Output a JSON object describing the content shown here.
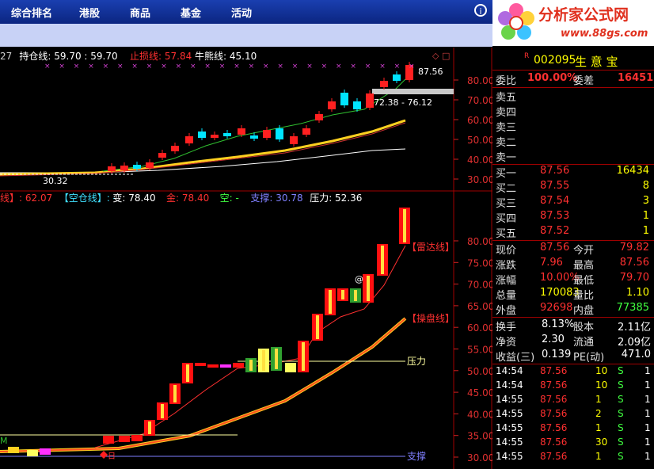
{
  "menu": [
    "综合排名",
    "港股",
    "商品",
    "基金",
    "活动"
  ],
  "logo": {
    "brand": "分析家公式网",
    "url": "www.88gs.com"
  },
  "upper_legend": [
    {
      "text": "27",
      "color": "#d0d0d0"
    },
    {
      "text": "持仓线: 59.70 : 59.70",
      "color": "#ffffff"
    },
    {
      "text": "止损线: 57.84",
      "color": "#ff3030"
    },
    {
      "text": "牛熊线: 45.10",
      "color": "#ffffff"
    }
  ],
  "upper_labels": {
    "high": "87.56",
    "low": "30.32",
    "band": "72.38 - 76.12",
    "corner": "◇ □"
  },
  "lower_legend": [
    {
      "text": "线】: 62.07",
      "color": "#ff3030"
    },
    {
      "text": "【空仓线】: -",
      "color": "#40e0ff"
    },
    {
      "text": "变: 78.40",
      "color": "#ffffff"
    },
    {
      "text": "金: 78.40",
      "color": "#ff3030"
    },
    {
      "text": "空: -",
      "color": "#40ff40"
    },
    {
      "text": "支撑: 30.78",
      "color": "#8080ff"
    },
    {
      "text": "压力: 52.36",
      "color": "#ffffff"
    }
  ],
  "lower_labels": {
    "leida": "【雷达线】",
    "caopan": "【操盘线】",
    "pressure": "压力",
    "support": "支撑",
    "m": "M",
    "ri": "日",
    "at": "@"
  },
  "upper_axis": [
    "80.00",
    "70.00",
    "60.00",
    "50.00",
    "40.00",
    "30.00"
  ],
  "lower_axis": [
    "80.00",
    "75.00",
    "70.00",
    "65.00",
    "60.00",
    "55.00",
    "50.00",
    "45.00",
    "40.00",
    "35.00",
    "30.00"
  ],
  "stock": {
    "code": "002095",
    "name": "生 意 宝",
    "r": "R"
  },
  "wei": {
    "label1": "委比",
    "value1": "100.00%",
    "label2": "委差",
    "value2": "16451"
  },
  "sell": [
    {
      "label": "卖五"
    },
    {
      "label": "卖四"
    },
    {
      "label": "卖三"
    },
    {
      "label": "卖二"
    },
    {
      "label": "卖一"
    }
  ],
  "buy": [
    {
      "label": "买一",
      "price": "87.56",
      "vol": "16434"
    },
    {
      "label": "买二",
      "price": "87.55",
      "vol": "8"
    },
    {
      "label": "买三",
      "price": "87.54",
      "vol": "3"
    },
    {
      "label": "买四",
      "price": "87.53",
      "vol": "1"
    },
    {
      "label": "买五",
      "price": "87.52",
      "vol": "1"
    }
  ],
  "quote": [
    {
      "l1": "现价",
      "v1": "87.56",
      "c1": "#ff3030",
      "l2": "今开",
      "v2": "79.82",
      "c2": "#ff3030"
    },
    {
      "l1": "涨跌",
      "v1": "7.96",
      "c1": "#ff3030",
      "l2": "最高",
      "v2": "87.56",
      "c2": "#ff3030"
    },
    {
      "l1": "涨幅",
      "v1": "10.00%",
      "c1": "#ff3030",
      "l2": "最低",
      "v2": "79.70",
      "c2": "#ff3030"
    },
    {
      "l1": "总量",
      "v1": "170083",
      "c1": "#ffff00",
      "l2": "量比",
      "v2": "1.10",
      "c2": "#ffff00"
    },
    {
      "l1": "外盘",
      "v1": "92698",
      "c1": "#ff3030",
      "l2": "内盘",
      "v2": "77385",
      "c2": "#40ff40"
    }
  ],
  "fund": [
    {
      "l1": "换手",
      "v1": "8.13%",
      "l2": "股本",
      "v2": "2.11亿"
    },
    {
      "l1": "净资",
      "v1": "2.30",
      "l2": "流通",
      "v2": "2.09亿"
    },
    {
      "l1": "收益(三)",
      "v1": "0.139",
      "l2": "PE(动)",
      "v2": "471.0"
    }
  ],
  "ticks": [
    {
      "time": "14:54",
      "price": "87.56",
      "vol": "10",
      "side": "S"
    },
    {
      "time": "14:54",
      "price": "87.56",
      "vol": "10",
      "side": "S"
    },
    {
      "time": "14:55",
      "price": "87.56",
      "vol": "1",
      "side": "S"
    },
    {
      "time": "14:55",
      "price": "87.56",
      "vol": "2",
      "side": "S"
    },
    {
      "time": "14:55",
      "price": "87.56",
      "vol": "1",
      "side": "S"
    },
    {
      "time": "14:55",
      "price": "87.56",
      "vol": "30",
      "side": "S"
    },
    {
      "time": "14:55",
      "price": "87.56",
      "vol": "1",
      "side": "S"
    }
  ],
  "tick_more": "1",
  "colors": {
    "up": "#ff2020",
    "down": "#00e5ff",
    "grid": "#8b0000",
    "panel_line": "#a00000"
  }
}
